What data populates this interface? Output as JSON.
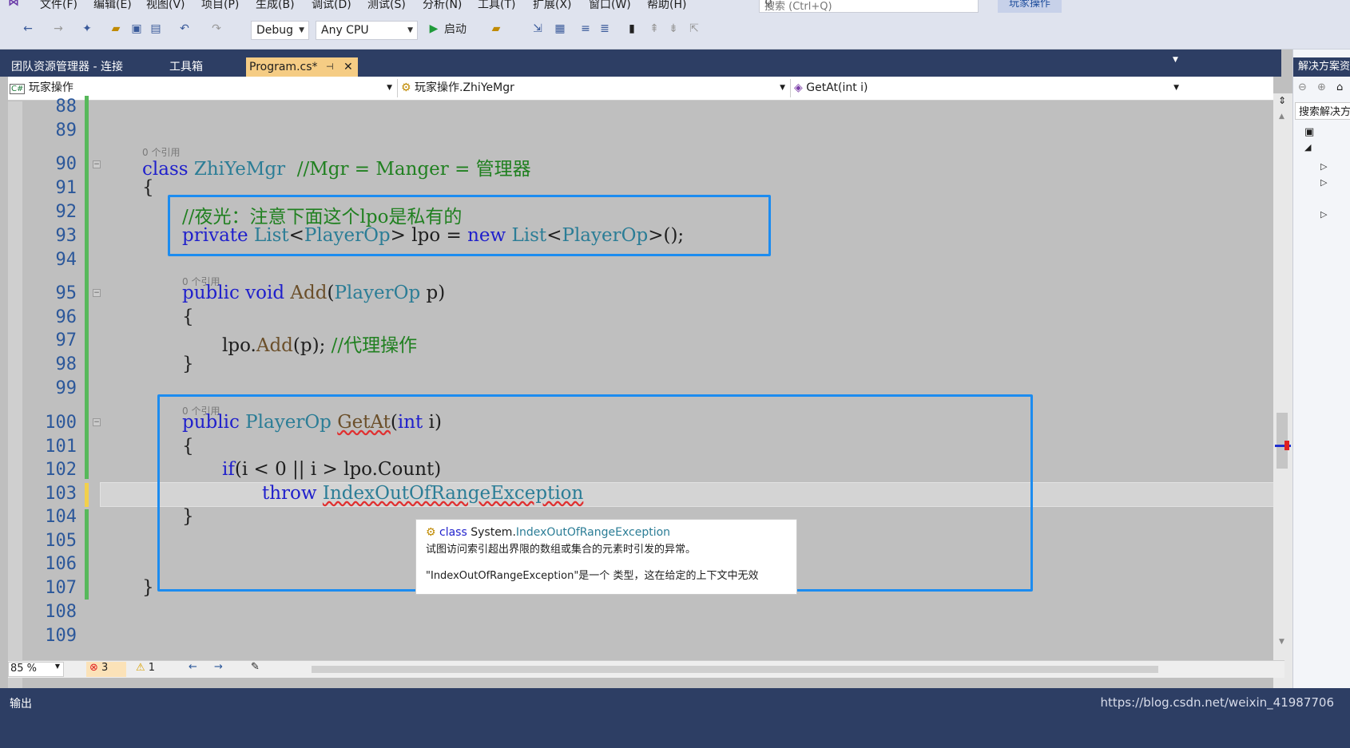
{
  "menu": {
    "items": [
      "文件(F)",
      "编辑(E)",
      "视图(V)",
      "项目(P)",
      "生成(B)",
      "调试(D)",
      "测试(S)",
      "分析(N)",
      "工具(T)",
      "扩展(X)",
      "窗口(W)",
      "帮助(H)"
    ],
    "search_placeholder": "搜索 (Ctrl+Q)",
    "project_title": "玩家操作"
  },
  "toolbar": {
    "config": "Debug",
    "platform": "Any CPU",
    "start_label": "启动"
  },
  "tabs": [
    {
      "label": "团队资源管理器 - 连接",
      "active": false
    },
    {
      "label": "工具箱",
      "active": false
    },
    {
      "label": "Program.cs*",
      "active": true
    }
  ],
  "navbar": {
    "project": "玩家操作",
    "class": "玩家操作.ZhiYeMgr",
    "member": "GetAt(int i)"
  },
  "editor": {
    "ref_label": "0 个引用",
    "line_numbers": [
      "88",
      "89",
      "90",
      "91",
      "92",
      "93",
      "94",
      "95",
      "96",
      "97",
      "98",
      "99",
      "100",
      "101",
      "102",
      "103",
      "104",
      "105",
      "106",
      "107",
      "108",
      "109"
    ]
  },
  "tooltip": {
    "kind": "class",
    "namespace": "System.",
    "type_name": "IndexOutOfRangeException",
    "description": "试图访问索引超出界限的数组或集合的元素时引发的异常。",
    "message": "\"IndexOutOfRangeException\"是一个 类型，这在给定的上下文中无效"
  },
  "status": {
    "zoom": "85 %",
    "errors": "3",
    "warnings": "1"
  },
  "output": {
    "title": "输出",
    "watermark": "https://blog.csdn.net/weixin_41987706"
  },
  "right_panel": {
    "title": "解决方案资源管理器",
    "search": "搜索解决方案"
  },
  "colors": {
    "highlight_border": "#1c8cf0",
    "active_tab": "#f5cc84",
    "tab_bar": "#2d3e64",
    "keyword": "#1f1fcc",
    "type": "#2b7d96",
    "comment": "#208020"
  }
}
